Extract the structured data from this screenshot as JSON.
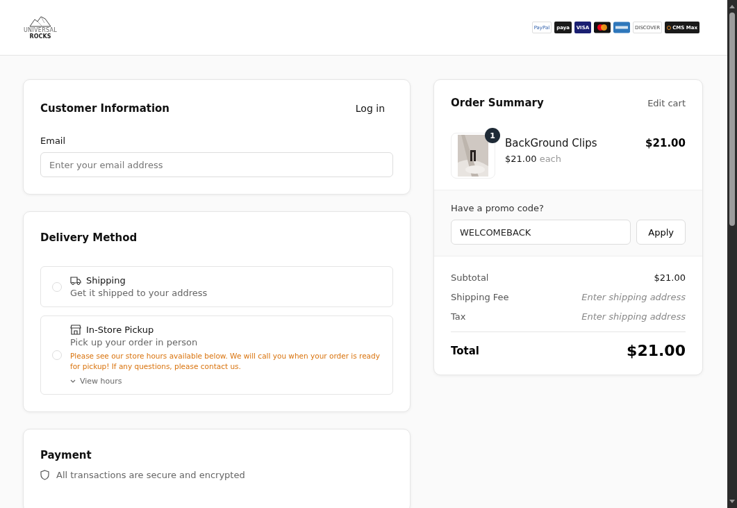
{
  "header": {
    "logo": {
      "line1": "UNIVERSAL",
      "line2": "ROCKS"
    },
    "payment_badges": [
      {
        "kind": "paypal",
        "label": "PayPal"
      },
      {
        "kind": "paya",
        "label": "paya"
      },
      {
        "kind": "visa",
        "label": "VISA"
      },
      {
        "kind": "mastercard"
      },
      {
        "kind": "amex"
      },
      {
        "kind": "discover",
        "label": "DISCOVER"
      },
      {
        "kind": "cms",
        "label": "CMS Max"
      }
    ]
  },
  "customer": {
    "title": "Customer Information",
    "login": "Log in",
    "email_label": "Email",
    "email_placeholder": "Enter your email address"
  },
  "delivery": {
    "title": "Delivery Method",
    "options": [
      {
        "kind": "shipping",
        "title": "Shipping",
        "subtitle": "Get it shipped to your address",
        "selected": false
      },
      {
        "kind": "pickup",
        "title": "In-Store Pickup",
        "subtitle": "Pick up your order in person",
        "note": "Please see our store hours available below. We will call you when your order is ready for pickup! If any questions, please contact us.",
        "link": "View hours",
        "selected": false
      }
    ]
  },
  "payment": {
    "title": "Payment",
    "secure_note": "All transactions are secure and encrypted"
  },
  "summary": {
    "title": "Order Summary",
    "edit": "Edit cart",
    "items": [
      {
        "name": "BackGround Clips",
        "quantity": "1",
        "unit_price": "$21.00",
        "unit_suffix": "each",
        "price": "$21.00"
      }
    ],
    "promo": {
      "label": "Have a promo code?",
      "value": "WELCOMEBACK",
      "button": "Apply"
    },
    "lines": [
      {
        "label": "Subtotal",
        "value": "$21.00",
        "pending": false
      },
      {
        "label": "Shipping Fee",
        "value": "Enter shipping address",
        "pending": true
      },
      {
        "label": "Tax",
        "value": "Enter shipping address",
        "pending": true
      }
    ],
    "total": {
      "label": "Total",
      "value": "$21.00"
    }
  }
}
